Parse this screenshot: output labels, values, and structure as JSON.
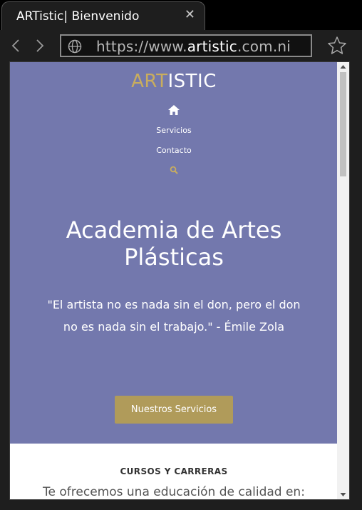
{
  "browser": {
    "tab_title": "ARTistic| Bienvenido",
    "tab_close": "✕",
    "url_prefix": "https://www.",
    "url_domain": "artistic",
    "url_suffix": ".com.ni"
  },
  "site": {
    "logo_art": "ART",
    "logo_istic": "ISTIC",
    "nav": {
      "servicios": "Servicios",
      "contacto": "Contacto"
    },
    "hero_title": "Academia de Artes Plásticas",
    "quote": "\"El artista no es nada sin el don, pero el don no es nada sin el trabajo.\" - Émile Zola",
    "cta_label": "Nuestros Servicios",
    "section_title": "CURSOS Y CARRERAS",
    "section_text": "Te ofrecemos una educación de calidad en:"
  },
  "colors": {
    "hero_bg": "#7378ad",
    "accent_gold": "#c9ad5e",
    "button_gold": "#b09b5a"
  },
  "icons": {
    "back": "arrow-left-icon",
    "forward": "arrow-right-icon",
    "globe": "globe-icon",
    "star": "star-icon",
    "home": "home-icon",
    "search": "search-icon"
  }
}
